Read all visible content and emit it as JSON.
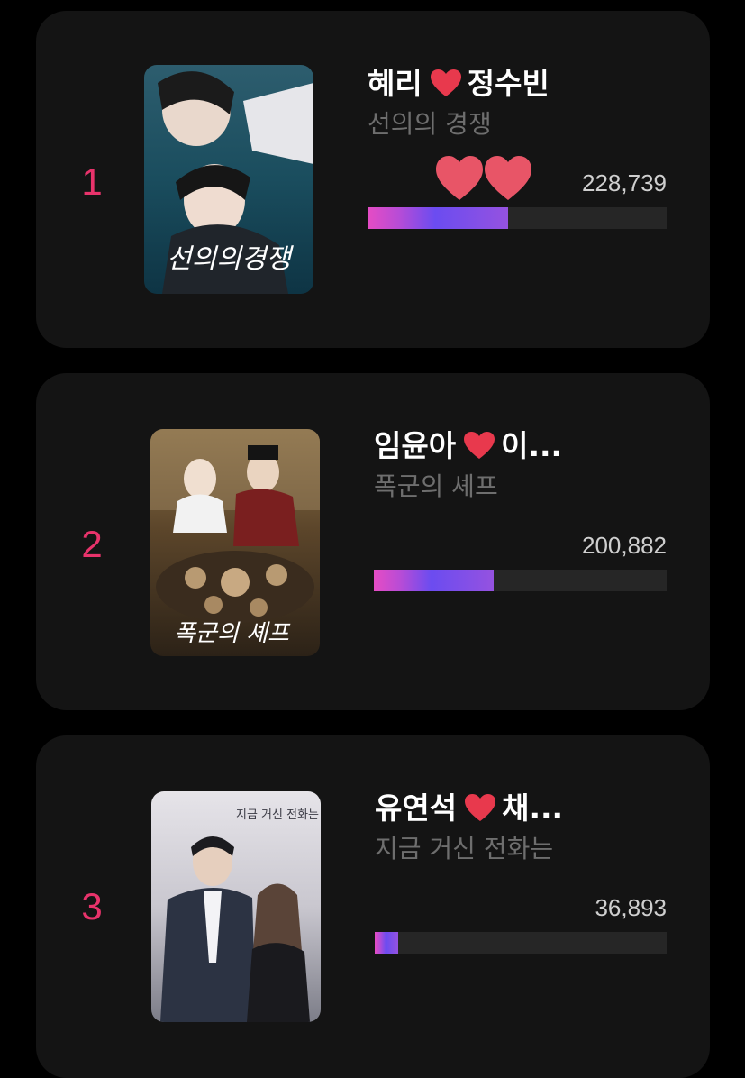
{
  "ranking": [
    {
      "rank": "1",
      "title_left": "혜리",
      "title_right": "정수빈",
      "drama": "선의의 경쟁",
      "votes": "228,739",
      "vote_share": 0.47,
      "has_big_hearts": true,
      "poster_text": "선의의경쟁",
      "poster_colors": [
        "#0f3d4d",
        "#1f6b80"
      ]
    },
    {
      "rank": "2",
      "title_left": "임윤아",
      "title_right": "이...",
      "drama": "폭군의 셰프",
      "votes": "200,882",
      "vote_share": 0.41,
      "has_big_hearts": false,
      "poster_text": "폭군의 셰프",
      "poster_colors": [
        "#4a3a25",
        "#8c6d45"
      ]
    },
    {
      "rank": "3",
      "title_left": "유연석",
      "title_right": "채...",
      "drama": "지금 거신 전화는",
      "votes": "36,893",
      "vote_share": 0.08,
      "has_big_hearts": false,
      "poster_text": "지금 거신 전화는",
      "poster_colors": [
        "#d8d6dc",
        "#3b3d48"
      ]
    }
  ],
  "colors": {
    "rank": "#e8336b",
    "card_bg": "#141414",
    "bar_track": "#262626",
    "heart": "#e8394d"
  },
  "icons": {
    "heart": "red-heart-icon",
    "big_hearts": "two-hearts-icon"
  }
}
